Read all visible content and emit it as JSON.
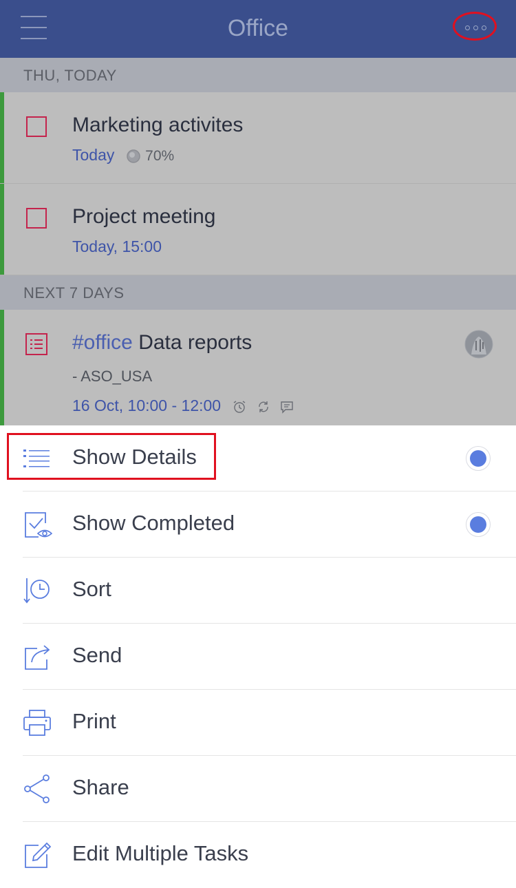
{
  "header": {
    "title": "Office"
  },
  "sections": {
    "today": "THU, TODAY",
    "next7": "NEXT 7 DAYS"
  },
  "tasks": [
    {
      "title": "Marketing activites",
      "date": "Today",
      "progress": "70%"
    },
    {
      "title": "Project meeting",
      "date": "Today, 15:00"
    },
    {
      "tag": "#office",
      "title": " Data reports",
      "note": "- ASO_USA",
      "date": "16 Oct, 10:00 - 12:00"
    }
  ],
  "menu": {
    "items": [
      {
        "label": "Show Details",
        "icon": "list-details-icon",
        "selected": true
      },
      {
        "label": "Show Completed",
        "icon": "completed-eye-icon",
        "selected": true
      },
      {
        "label": "Sort",
        "icon": "sort-clock-icon"
      },
      {
        "label": "Send",
        "icon": "send-icon"
      },
      {
        "label": "Print",
        "icon": "printer-icon"
      },
      {
        "label": "Share",
        "icon": "share-icon"
      },
      {
        "label": "Edit Multiple Tasks",
        "icon": "edit-icon"
      }
    ]
  },
  "colors": {
    "header": "#3a4e8c",
    "accent": "#5a7ddf",
    "highlight": "#e0101f",
    "green": "#3d9a3d",
    "checkbox": "#c4234c"
  }
}
